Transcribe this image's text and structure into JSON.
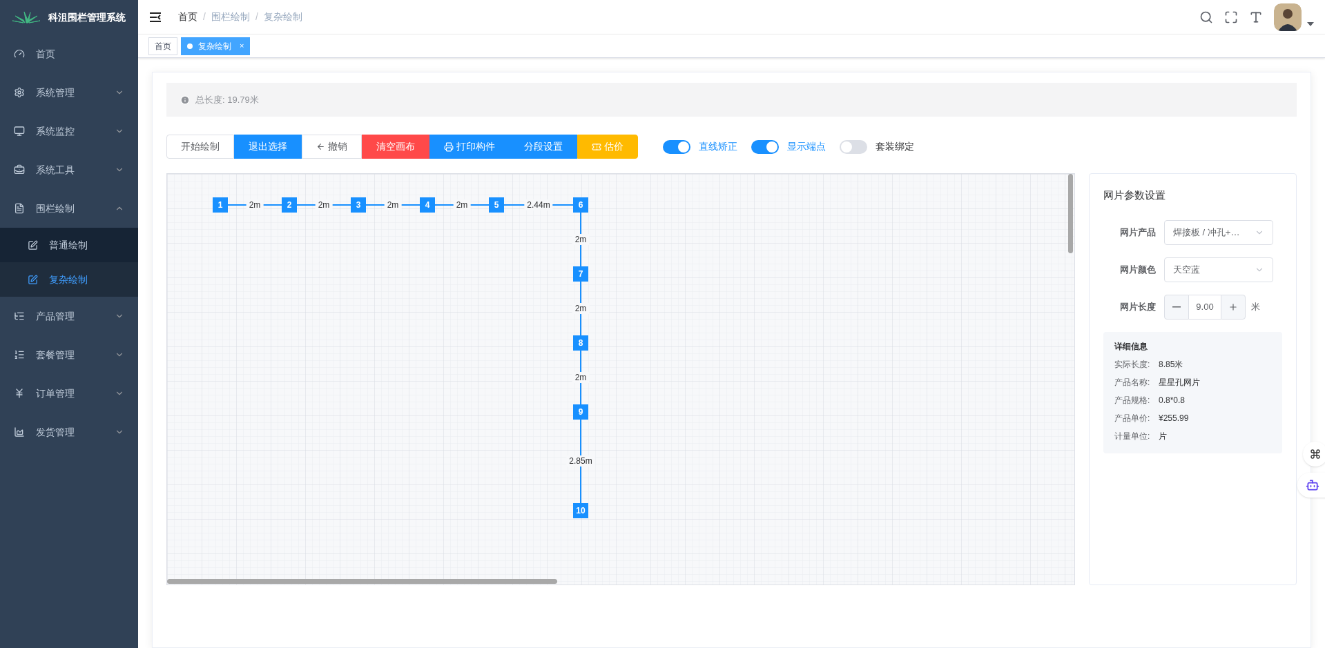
{
  "sidebar": {
    "title": "科沮围栏管理系统",
    "items": [
      {
        "label": "首页",
        "kind": "link"
      },
      {
        "label": "系统管理",
        "kind": "group",
        "expanded": false
      },
      {
        "label": "系统监控",
        "kind": "group",
        "expanded": false
      },
      {
        "label": "系统工具",
        "kind": "group",
        "expanded": false
      },
      {
        "label": "围栏绘制",
        "kind": "group",
        "expanded": true,
        "children": [
          {
            "label": "普通绘制",
            "selected": false
          },
          {
            "label": "复杂绘制",
            "selected": true
          }
        ]
      },
      {
        "label": "产品管理",
        "kind": "group",
        "expanded": false
      },
      {
        "label": "套餐管理",
        "kind": "group",
        "expanded": false
      },
      {
        "label": "订单管理",
        "kind": "group",
        "expanded": false
      },
      {
        "label": "发货管理",
        "kind": "group",
        "expanded": false
      }
    ]
  },
  "breadcrumb": {
    "separator": "/",
    "items": [
      "首页",
      "围栏绘制",
      "复杂绘制"
    ]
  },
  "tabs": [
    {
      "label": "首页",
      "selected": false
    },
    {
      "label": "复杂绘制",
      "selected": true,
      "close": "×"
    }
  ],
  "info": {
    "text": "总长度: 19.79米"
  },
  "toolbar": [
    {
      "label": "开始绘制",
      "kind": "default"
    },
    {
      "label": "退出选择",
      "kind": "primary"
    },
    {
      "label": "撤销",
      "kind": "default"
    },
    {
      "label": "清空画布",
      "kind": "danger"
    },
    {
      "label": "打印构件",
      "kind": "primary"
    },
    {
      "label": "分段设置",
      "kind": "primary"
    },
    {
      "label": "估价",
      "kind": "warning"
    }
  ],
  "switches": [
    {
      "label": "直线矫正",
      "on": true
    },
    {
      "label": "显示端点",
      "on": true
    },
    {
      "label": "套装绑定",
      "on": false
    }
  ],
  "canvas": {
    "nodes": [
      "1",
      "2",
      "3",
      "4",
      "5",
      "6",
      "7",
      "8",
      "9",
      "10"
    ],
    "runs": [
      {
        "kind": "horizontal",
        "segments": [
          "2m",
          "2m",
          "2m",
          "2m",
          "2.44m"
        ]
      },
      {
        "kind": "vertical",
        "segments": [
          "2m",
          "2m",
          "2m",
          "2.85m"
        ]
      }
    ]
  },
  "panel": {
    "title": "网片参数设置",
    "product": {
      "label": "网片产品",
      "value": "焊接板 / 冲孔+…"
    },
    "color": {
      "label": "网片颜色",
      "value": "天空蓝"
    },
    "length": {
      "label": "网片长度",
      "value": "9.00",
      "unit": "米"
    },
    "details": {
      "title": "详细信息",
      "rows": [
        {
          "label": "实际长度:",
          "value": "8.85米"
        },
        {
          "label": "产品名称:",
          "value": "星星孔网片"
        },
        {
          "label": "产品规格:",
          "value": "0.8*0.8"
        },
        {
          "label": "产品单价:",
          "value": "¥255.99"
        },
        {
          "label": "计量单位:",
          "value": "片"
        }
      ]
    }
  }
}
